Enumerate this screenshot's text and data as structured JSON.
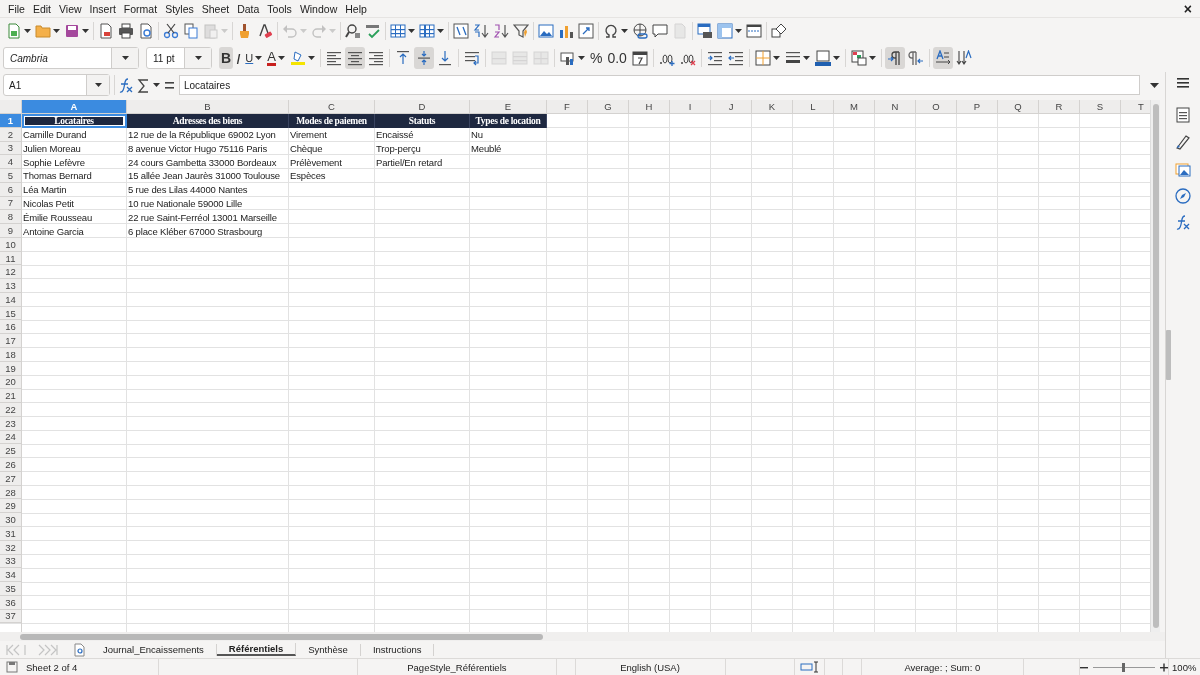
{
  "menu": [
    "File",
    "Edit",
    "View",
    "Insert",
    "Format",
    "Styles",
    "Sheet",
    "Data",
    "Tools",
    "Window",
    "Help"
  ],
  "close_label": "×",
  "standard_toolbar": [
    {
      "kind": "new",
      "dropdown": true,
      "disabled": false
    },
    {
      "kind": "open",
      "dropdown": true,
      "disabled": false
    },
    {
      "kind": "save",
      "dropdown": true,
      "disabled": false
    },
    {
      "kind": "separator"
    },
    {
      "kind": "export-pdf",
      "dropdown": false,
      "disabled": false
    },
    {
      "kind": "print",
      "dropdown": false,
      "disabled": false
    },
    {
      "kind": "preview",
      "dropdown": false,
      "disabled": false
    },
    {
      "kind": "separator"
    },
    {
      "kind": "cut",
      "dropdown": false,
      "disabled": false
    },
    {
      "kind": "copy",
      "dropdown": false,
      "disabled": false
    },
    {
      "kind": "paste",
      "dropdown": true,
      "disabled": true
    },
    {
      "kind": "separator"
    },
    {
      "kind": "clone",
      "dropdown": false,
      "disabled": false
    },
    {
      "kind": "clear",
      "dropdown": false,
      "disabled": false
    },
    {
      "kind": "separator"
    },
    {
      "kind": "undo",
      "dropdown": true,
      "disabled": true
    },
    {
      "kind": "redo",
      "dropdown": true,
      "disabled": true
    },
    {
      "kind": "separator"
    },
    {
      "kind": "find",
      "dropdown": false,
      "disabled": false
    },
    {
      "kind": "spelling",
      "dropdown": false,
      "disabled": false
    },
    {
      "kind": "separator"
    },
    {
      "kind": "rows",
      "dropdown": true,
      "disabled": false
    },
    {
      "kind": "columns",
      "dropdown": true,
      "disabled": false
    },
    {
      "kind": "separator"
    },
    {
      "kind": "sort",
      "dropdown": false,
      "disabled": false
    },
    {
      "kind": "sort-ascending",
      "dropdown": false,
      "disabled": false
    },
    {
      "kind": "sort-descending",
      "dropdown": false,
      "disabled": false
    },
    {
      "kind": "autofilter",
      "dropdown": false,
      "disabled": false
    },
    {
      "kind": "separator"
    },
    {
      "kind": "image",
      "dropdown": false,
      "disabled": false
    },
    {
      "kind": "chart",
      "dropdown": false,
      "disabled": false
    },
    {
      "kind": "pivot",
      "dropdown": false,
      "disabled": false
    },
    {
      "kind": "separator"
    },
    {
      "kind": "special-character",
      "dropdown": true,
      "disabled": false
    },
    {
      "kind": "hyperlink",
      "dropdown": false,
      "disabled": false
    },
    {
      "kind": "comment",
      "dropdown": false,
      "disabled": false
    },
    {
      "kind": "header-footer",
      "dropdown": false,
      "disabled": true
    },
    {
      "kind": "separator"
    },
    {
      "kind": "print-range",
      "dropdown": false,
      "disabled": false
    },
    {
      "kind": "freeze",
      "dropdown": true,
      "disabled": false
    },
    {
      "kind": "split",
      "dropdown": false,
      "disabled": false
    },
    {
      "kind": "separator"
    },
    {
      "kind": "shapes",
      "dropdown": false,
      "disabled": false
    }
  ],
  "format_toolbar": {
    "font_name": "Cambria",
    "font_size": "11 pt",
    "items": [
      {
        "kind": "bold",
        "label": "B",
        "active": true,
        "dropdown": false,
        "disabled": false
      },
      {
        "kind": "italic",
        "label": "I",
        "active": false,
        "dropdown": false,
        "disabled": false
      },
      {
        "kind": "underline",
        "label": "U",
        "active": false,
        "dropdown": true,
        "disabled": false
      },
      {
        "kind": "font-color",
        "label": "A",
        "active": false,
        "dropdown": true,
        "disabled": false
      },
      {
        "kind": "highlight",
        "active": false,
        "dropdown": true,
        "disabled": false
      },
      {
        "kind": "separator"
      },
      {
        "kind": "align-left",
        "active": false,
        "dropdown": false,
        "disabled": false
      },
      {
        "kind": "align-center",
        "active": true,
        "dropdown": false,
        "disabled": false
      },
      {
        "kind": "align-right",
        "active": false,
        "dropdown": false,
        "disabled": false
      },
      {
        "kind": "separator"
      },
      {
        "kind": "align-top",
        "active": false,
        "dropdown": false,
        "disabled": false
      },
      {
        "kind": "align-middle",
        "active": true,
        "dropdown": false,
        "disabled": false
      },
      {
        "kind": "align-bottom",
        "active": false,
        "dropdown": false,
        "disabled": false
      },
      {
        "kind": "separator"
      },
      {
        "kind": "wrap",
        "active": false,
        "dropdown": false,
        "disabled": false
      },
      {
        "kind": "separator"
      },
      {
        "kind": "merge-center",
        "active": false,
        "dropdown": false,
        "disabled": true
      },
      {
        "kind": "merge",
        "active": false,
        "dropdown": false,
        "disabled": true
      },
      {
        "kind": "unmerge",
        "active": false,
        "dropdown": false,
        "disabled": true
      },
      {
        "kind": "separator"
      },
      {
        "kind": "currency",
        "active": false,
        "dropdown": true,
        "disabled": false
      },
      {
        "kind": "percent",
        "label": "%",
        "active": false,
        "dropdown": false,
        "disabled": false
      },
      {
        "kind": "number",
        "label": "0.0",
        "active": false,
        "dropdown": false,
        "disabled": false
      },
      {
        "kind": "date",
        "active": false,
        "dropdown": false,
        "disabled": false
      },
      {
        "kind": "separator"
      },
      {
        "kind": "add-decimal",
        "active": false,
        "dropdown": false,
        "disabled": false
      },
      {
        "kind": "delete-decimal",
        "active": false,
        "dropdown": false,
        "disabled": false
      },
      {
        "kind": "separator"
      },
      {
        "kind": "indent-increase",
        "active": false,
        "dropdown": false,
        "disabled": false
      },
      {
        "kind": "indent-decrease",
        "active": false,
        "dropdown": false,
        "disabled": false
      },
      {
        "kind": "separator"
      },
      {
        "kind": "borders",
        "active": false,
        "dropdown": true,
        "disabled": false
      },
      {
        "kind": "border-style",
        "active": false,
        "dropdown": true,
        "disabled": false
      },
      {
        "kind": "border-color",
        "active": false,
        "dropdown": true,
        "disabled": false
      },
      {
        "kind": "separator"
      },
      {
        "kind": "conditional",
        "active": false,
        "dropdown": true,
        "disabled": false
      },
      {
        "kind": "separator"
      },
      {
        "kind": "left-to-right",
        "active": true,
        "dropdown": false,
        "disabled": false
      },
      {
        "kind": "right-to-left",
        "active": false,
        "dropdown": false,
        "disabled": false
      },
      {
        "kind": "separator"
      },
      {
        "kind": "text-horizontal",
        "active": true,
        "dropdown": false,
        "disabled": false
      },
      {
        "kind": "text-vertical",
        "active": false,
        "dropdown": false,
        "disabled": false
      }
    ]
  },
  "formula_bar": {
    "name_box": "A1",
    "content": "Locataires"
  },
  "sheet": {
    "columns": [
      {
        "label": "A",
        "selected": true
      },
      {
        "label": "B",
        "selected": false
      },
      {
        "label": "C",
        "selected": false
      },
      {
        "label": "D",
        "selected": false
      },
      {
        "label": "E",
        "selected": false
      },
      {
        "label": "F",
        "selected": false
      },
      {
        "label": "G",
        "selected": false
      },
      {
        "label": "H",
        "selected": false
      },
      {
        "label": "I",
        "selected": false
      },
      {
        "label": "J",
        "selected": false
      },
      {
        "label": "K",
        "selected": false
      },
      {
        "label": "L",
        "selected": false
      },
      {
        "label": "M",
        "selected": false
      },
      {
        "label": "N",
        "selected": false
      },
      {
        "label": "O",
        "selected": false
      },
      {
        "label": "P",
        "selected": false
      },
      {
        "label": "Q",
        "selected": false
      },
      {
        "label": "R",
        "selected": false
      },
      {
        "label": "S",
        "selected": false
      },
      {
        "label": "T",
        "selected": false
      }
    ],
    "rows": [
      {
        "label": "1",
        "selected": true
      },
      {
        "label": "2",
        "selected": false
      },
      {
        "label": "3",
        "selected": false
      },
      {
        "label": "4",
        "selected": false
      },
      {
        "label": "5",
        "selected": false
      },
      {
        "label": "6",
        "selected": false
      },
      {
        "label": "7",
        "selected": false
      },
      {
        "label": "8",
        "selected": false
      },
      {
        "label": "9",
        "selected": false
      },
      {
        "label": "10",
        "selected": false
      },
      {
        "label": "11",
        "selected": false
      },
      {
        "label": "12",
        "selected": false
      },
      {
        "label": "13",
        "selected": false
      },
      {
        "label": "14",
        "selected": false
      },
      {
        "label": "15",
        "selected": false
      },
      {
        "label": "16",
        "selected": false
      },
      {
        "label": "17",
        "selected": false
      },
      {
        "label": "18",
        "selected": false
      },
      {
        "label": "19",
        "selected": false
      },
      {
        "label": "20",
        "selected": false
      },
      {
        "label": "21",
        "selected": false
      },
      {
        "label": "22",
        "selected": false
      },
      {
        "label": "23",
        "selected": false
      },
      {
        "label": "24",
        "selected": false
      },
      {
        "label": "25",
        "selected": false
      },
      {
        "label": "26",
        "selected": false
      },
      {
        "label": "27",
        "selected": false
      },
      {
        "label": "28",
        "selected": false
      },
      {
        "label": "29",
        "selected": false
      },
      {
        "label": "30",
        "selected": false
      },
      {
        "label": "31",
        "selected": false
      },
      {
        "label": "32",
        "selected": false
      },
      {
        "label": "33",
        "selected": false
      },
      {
        "label": "34",
        "selected": false
      },
      {
        "label": "35",
        "selected": false
      },
      {
        "label": "36",
        "selected": false
      },
      {
        "label": "37",
        "selected": false
      }
    ],
    "cells": [
      [
        "Locataires",
        "Adresses des biens",
        "Modes de paiemen",
        "Statuts",
        "Types de location"
      ],
      [
        "Camille Durand",
        "12 rue de la République 69002 Lyon",
        "Virement",
        "Encaissé",
        "Nu"
      ],
      [
        "Julien Moreau",
        "8 avenue Victor Hugo 75116 Paris",
        "Chèque",
        "Trop-perçu",
        "Meublé"
      ],
      [
        "Sophie Lefèvre",
        "24 cours Gambetta 33000 Bordeaux",
        "Prélèvement",
        "Partiel/En retard",
        ""
      ],
      [
        "Thomas Bernard",
        "15 allée Jean Jaurès 31000 Toulouse",
        "Espèces",
        "",
        ""
      ],
      [
        "Léa Martin",
        "5 rue des Lilas 44000 Nantes",
        "",
        "",
        ""
      ],
      [
        "Nicolas Petit",
        "10 rue Nationale 59000 Lille",
        "",
        "",
        ""
      ],
      [
        "Émilie Rousseau",
        "22 rue Saint-Ferréol 13001 Marseille",
        "",
        "",
        ""
      ],
      [
        "Antoine Garcia",
        "6 place Kléber 67000 Strasbourg",
        "",
        "",
        ""
      ]
    ]
  },
  "sheet_tabs": [
    {
      "label": "Journal_Encaissements",
      "selected": false
    },
    {
      "label": "Référentiels",
      "selected": true
    },
    {
      "label": "Synthèse",
      "selected": false
    },
    {
      "label": "Instructions",
      "selected": false
    }
  ],
  "status_bar": {
    "sheet": "Sheet 2 of 4",
    "page_style": "PageStyle_Référentiels",
    "language": "English (USA)",
    "summary": "Average: ; Sum: 0",
    "zoom_slider": {
      "level": 0.5
    },
    "zoom": "100%"
  }
}
